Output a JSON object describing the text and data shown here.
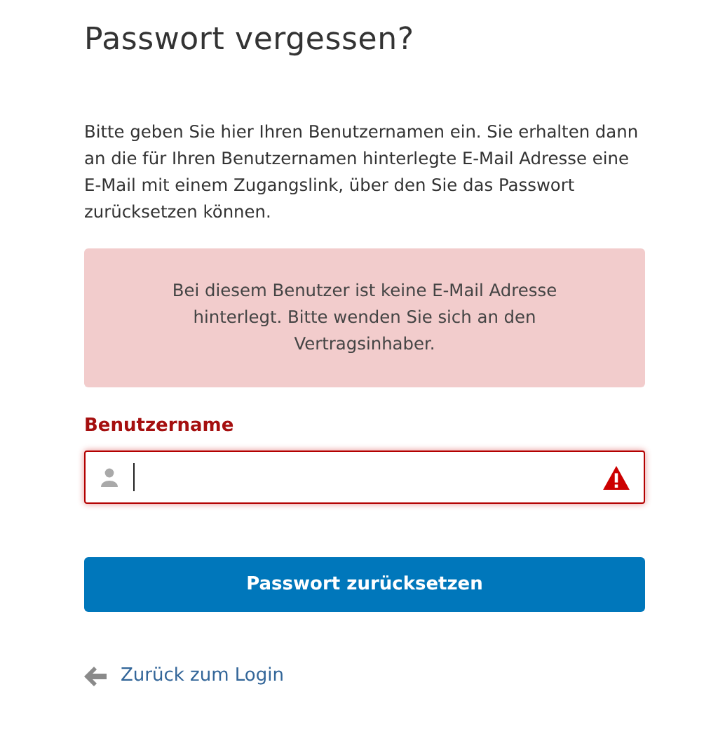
{
  "title": "Passwort vergessen?",
  "intro": "Bitte geben Sie hier Ihren Benutzernamen ein. Sie erhalten dann an die für Ihren Benutzernamen hinterlegte E-Mail Adresse eine E-Mail mit einem Zugangslink, über den Sie das Passwort zurücksetzen können.",
  "alert": {
    "kind": "error",
    "text": "Bei diesem Benutzer ist keine E-Mail Adresse hinterlegt. Bitte wenden Sie sich an den Vertragsinhaber."
  },
  "field": {
    "label": "Benutzername",
    "error": true,
    "focused": true
  },
  "submit": "Passwort zurücksetzen",
  "back_link": "Zurück zum Login"
}
